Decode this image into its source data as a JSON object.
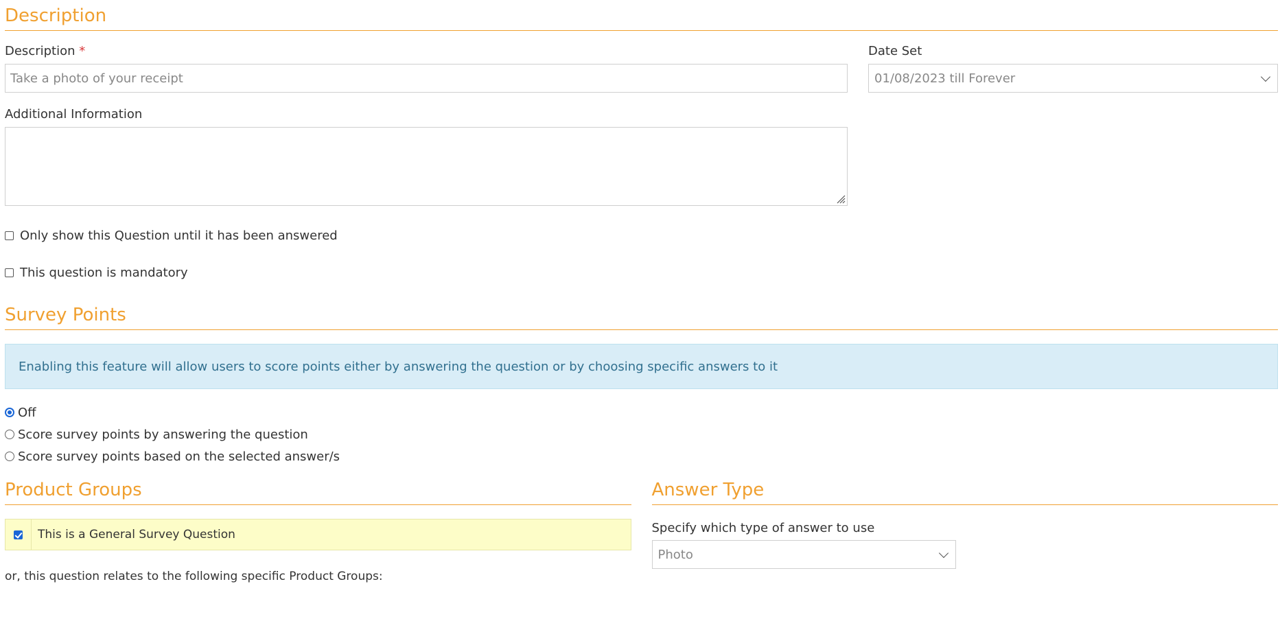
{
  "description_section": {
    "title": "Description",
    "description_label": "Description",
    "required_mark": "*",
    "description_value": "Take a photo of your receipt",
    "date_set_label": "Date Set",
    "date_set_value": "01/08/2023 till Forever",
    "additional_info_label": "Additional Information",
    "additional_info_value": "",
    "checkboxes": [
      {
        "label": "Only show this Question until it has been answered",
        "checked": false
      },
      {
        "label": "This question is mandatory",
        "checked": false
      }
    ]
  },
  "survey_points": {
    "title": "Survey Points",
    "info_text": "Enabling this feature will allow users to score points either by answering the question or by choosing specific answers to it",
    "options": [
      {
        "label": "Off",
        "selected": true
      },
      {
        "label": "Score survey points by answering the question",
        "selected": false
      },
      {
        "label": "Score survey points based on the selected answer/s",
        "selected": false
      }
    ]
  },
  "product_groups": {
    "title": "Product Groups",
    "general_label": "This is a General Survey Question",
    "general_checked": true,
    "specific_text": "or, this question relates to the following specific Product Groups:"
  },
  "answer_type": {
    "title": "Answer Type",
    "label": "Specify which type of answer to use",
    "selected_value": "Photo"
  },
  "colors": {
    "accent": "#f0a030",
    "info_bg": "#d9edf7",
    "info_text": "#31708f",
    "highlight_bg": "#fdfdc8",
    "checkbox_blue": "#1a66d6",
    "required": "#d9383a"
  }
}
